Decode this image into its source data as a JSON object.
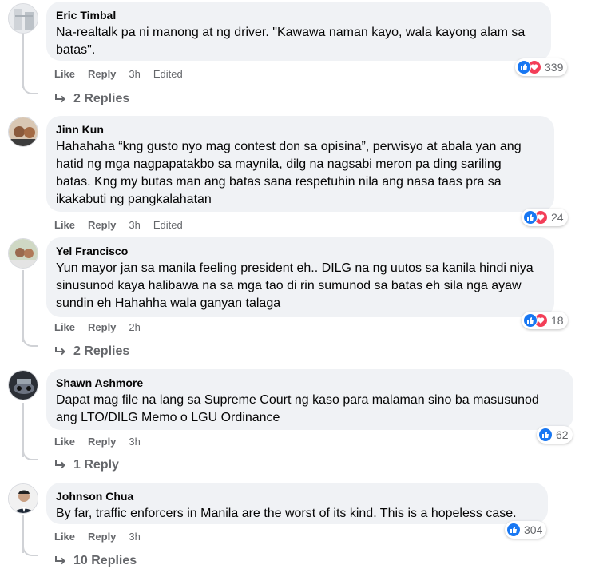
{
  "comments": [
    {
      "author": "Eric Timbal",
      "lines": [
        "Na-realtalk pa ni manong at ng driver. \"Kawawa naman kayo, wala kayong alam sa",
        "batas\"."
      ],
      "like": "Like",
      "reply": "Reply",
      "time": "3h",
      "edited": "Edited",
      "reaction_count": "339",
      "replies": "2 Replies"
    },
    {
      "author": "Jinn Kun",
      "lines": [
        "Hahahaha “kng gusto nyo mag contest don sa opisina”, perwisyo at abala yan ang",
        "hatid ng mga nagpapatakbo sa maynila, dilg na nagsabi meron pa ding sariling",
        "batas. Kng my butas man ang batas sana respetuhin nila ang nasa taas pra sa",
        "ikakabuti ng pangkalahatan"
      ],
      "like": "Like",
      "reply": "Reply",
      "time": "3h",
      "edited": "Edited",
      "reaction_count": "24"
    },
    {
      "author": "Yel Francisco",
      "lines": [
        "Yun mayor jan sa manila feeling president eh.. DILG na ng uutos sa kanila hindi niya",
        "sinusunod kaya halibawa na sa mga tao di rin sumunod sa batas eh sila nga ayaw",
        "sundin eh Hahahha wala ganyan talaga"
      ],
      "like": "Like",
      "reply": "Reply",
      "time": "2h",
      "reaction_count": "18",
      "replies": "2 Replies"
    },
    {
      "author": "Shawn Ashmore",
      "lines": [
        "Dapat mag file na lang sa Supreme Court ng kaso para malaman sino ba masusunod",
        "ang LTO/DILG Memo o LGU Ordinance"
      ],
      "like": "Like",
      "reply": "Reply",
      "time": "3h",
      "reaction_count": "62",
      "replies": "1 Reply"
    },
    {
      "author": "Johnson Chua",
      "lines": [
        "By far, traffic enforcers in Manila are the worst of its kind. This is a hopeless case."
      ],
      "like": "Like",
      "reply": "Reply",
      "time": "3h",
      "reaction_count": "304",
      "replies": "10 Replies"
    }
  ],
  "colors": {
    "like_blue": "#1877f2",
    "love_red": "#f33e58",
    "bubble_bg": "#f0f2f5",
    "meta_gray": "#65676b"
  },
  "icons": {
    "like": "thumbs-up-icon",
    "love": "heart-icon",
    "reply_arrow": "reply-arrow-icon"
  }
}
